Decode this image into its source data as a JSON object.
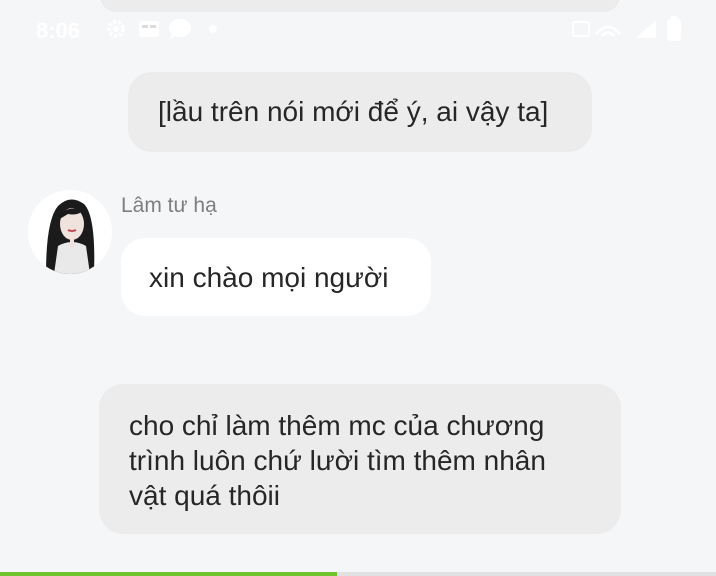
{
  "status_bar": {
    "time": "8:06",
    "left_icons": [
      "gear-icon",
      "card-icon",
      "chat-bubble-icon",
      "dot-icon"
    ],
    "right_icons": [
      "volte-wifi-icon",
      "signal-icon",
      "battery-icon"
    ]
  },
  "messages": [
    {
      "type": "incoming",
      "text": "[lầu trên nói mới để ý, ai vậy ta]"
    },
    {
      "type": "incoming",
      "sender": "Lâm tư hạ",
      "text": "xin chào mọi người"
    },
    {
      "type": "incoming",
      "lines": [
        "cho chỉ làm thêm mc của chương",
        "trình luôn chứ lười tìm thêm nhân",
        "vật quá thôii"
      ]
    }
  ],
  "progress": {
    "fraction": 0.47,
    "color": "#70c42e"
  },
  "colors": {
    "background": "#f5f6f8",
    "bubble_gray": "#ececec",
    "bubble_white": "#ffffff",
    "text": "#262626",
    "sender_name": "#7e7e7e"
  }
}
